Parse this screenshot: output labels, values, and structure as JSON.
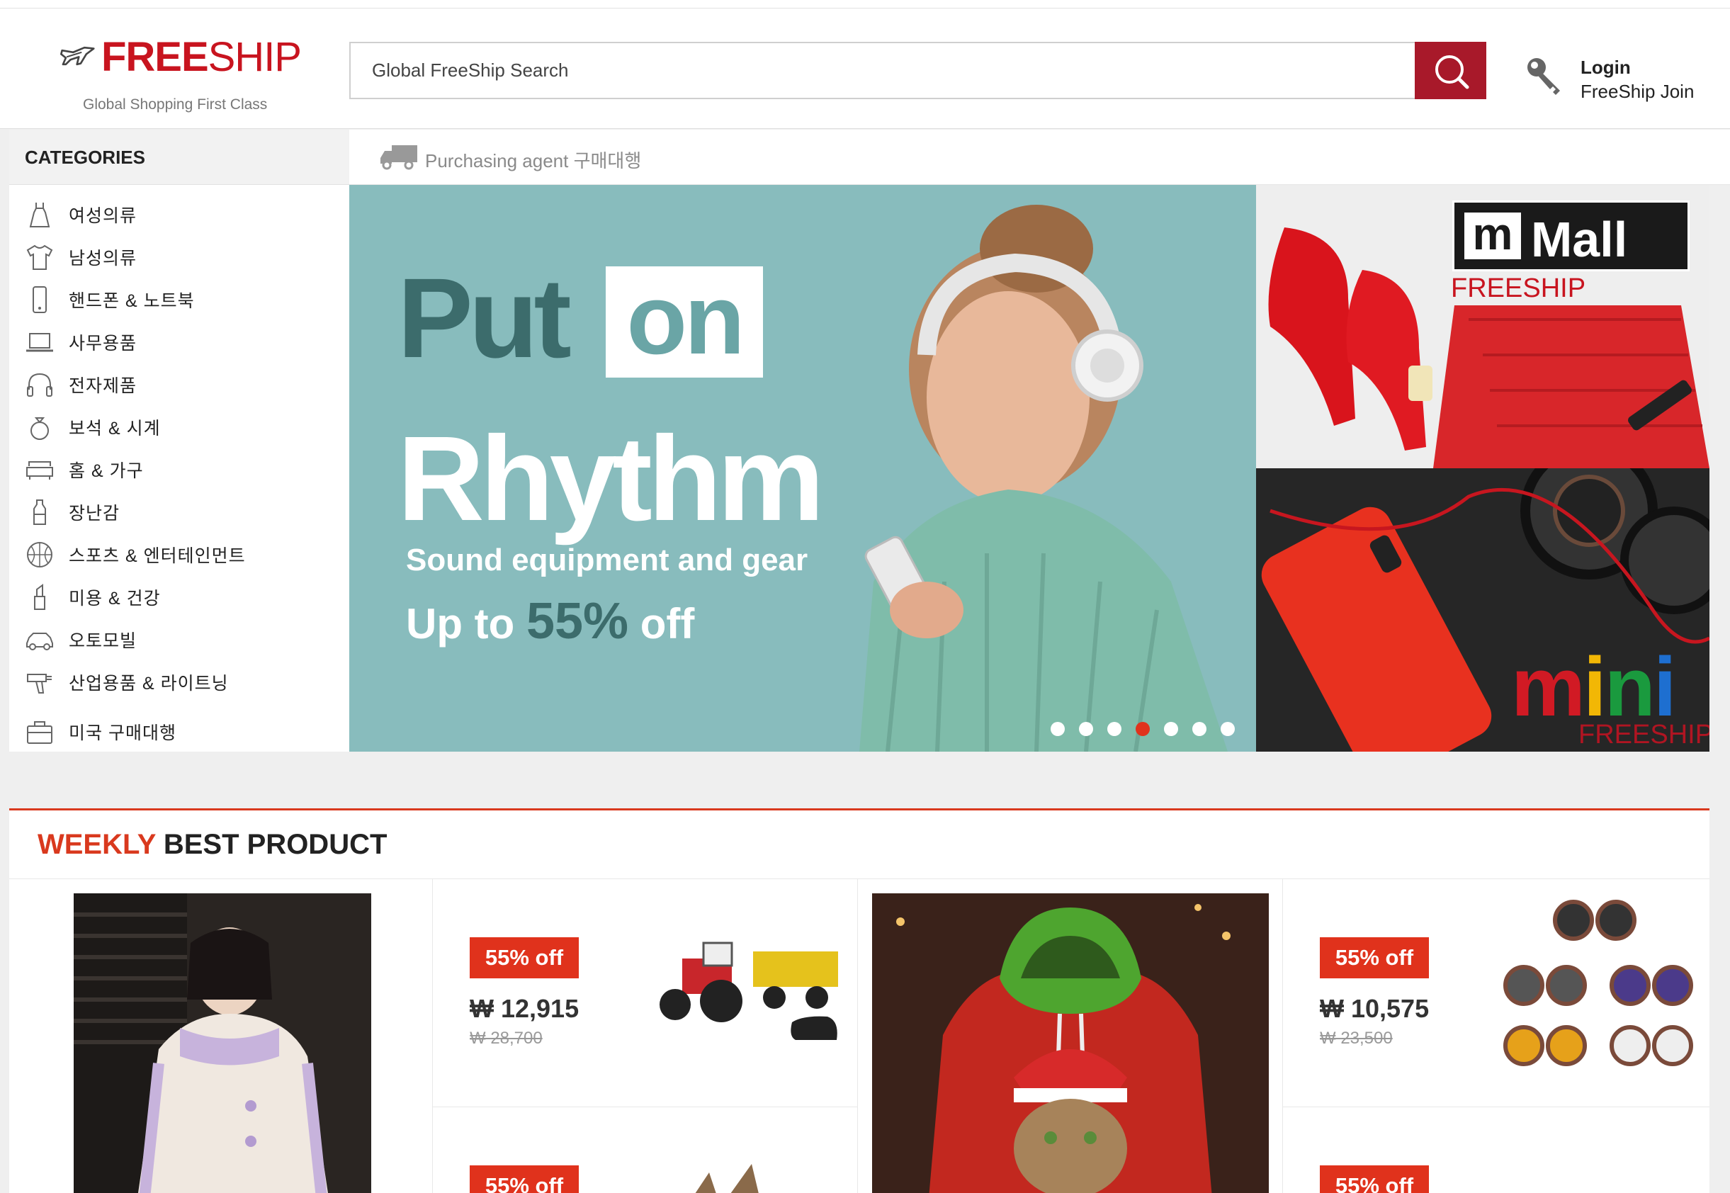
{
  "brand": {
    "name_bold": "FREE",
    "name_light": "SHIP",
    "tagline": "Global Shopping First Class",
    "accent_color": "#c8141f"
  },
  "search": {
    "placeholder": "Global FreeShip Search",
    "button_icon": "search-icon"
  },
  "account": {
    "login": "Login",
    "join": "FreeShip Join",
    "icon": "key-icon"
  },
  "categories": {
    "title": "CATEGORIES",
    "items": [
      {
        "label": "여성의류",
        "icon": "dress-icon"
      },
      {
        "label": "남성의류",
        "icon": "shirt-icon"
      },
      {
        "label": "핸드폰 & 노트북",
        "icon": "phone-icon"
      },
      {
        "label": "사무용품",
        "icon": "laptop-icon"
      },
      {
        "label": "전자제품",
        "icon": "headphones-icon"
      },
      {
        "label": "보석 & 시계",
        "icon": "ring-icon"
      },
      {
        "label": "홈 & 가구",
        "icon": "sofa-icon"
      },
      {
        "label": "장난감",
        "icon": "bottle-icon"
      },
      {
        "label": "스포츠 & 엔터테인먼트",
        "icon": "basketball-icon"
      },
      {
        "label": "미용 & 건강",
        "icon": "lipstick-icon"
      },
      {
        "label": "오토모빌",
        "icon": "car-icon"
      },
      {
        "label": "산업용품 & 라이트닝",
        "icon": "drill-icon"
      },
      {
        "label": "미국 구매대행",
        "icon": "bag-icon"
      }
    ]
  },
  "agent_bar": {
    "label": "Purchasing agent 구매대행",
    "icon": "truck-icon"
  },
  "hero": {
    "line1": "Put",
    "line1_box": "on",
    "line2": "Rhythm",
    "subtitle": "Sound equipment and gear",
    "offer_prefix": "Up to ",
    "offer_value": "55%",
    "offer_suffix": " off",
    "slide_count": 7,
    "active_slide": 4
  },
  "promos": {
    "top": {
      "badge_m": "m",
      "badge_text": "Mall",
      "sub": "FREESHIP"
    },
    "bottom": {
      "text": "mini",
      "sub": "FREESHIP"
    }
  },
  "weekly": {
    "title_accent": "WEEKLY",
    "title_rest": " BEST PRODUCT",
    "products": [
      {
        "badge": "55% off",
        "price": "₩ 12,915",
        "old_price": "₩ 28,700"
      },
      {
        "badge": "55% off",
        "price": "₩ 10,575",
        "old_price": "₩ 23,500"
      },
      {
        "badge": "55% off"
      },
      {
        "badge": "55% off"
      }
    ]
  }
}
